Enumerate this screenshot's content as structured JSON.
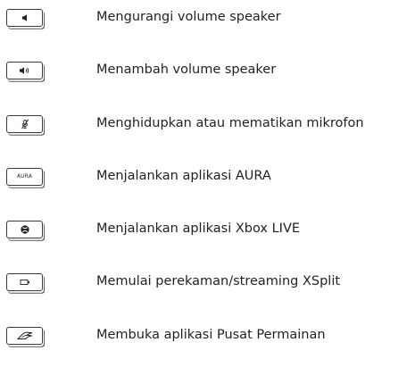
{
  "hotkeys": [
    {
      "icon": "volume-down-icon",
      "key_text": "",
      "description": "Mengurangi volume speaker"
    },
    {
      "icon": "volume-up-icon",
      "key_text": "",
      "description": "Menambah volume speaker"
    },
    {
      "icon": "mic-mute-icon",
      "key_text": "",
      "description": "Menghidupkan atau mematikan mikrofon"
    },
    {
      "icon": "aura-text-icon",
      "key_text": "AURA",
      "description": "Menjalankan aplikasi AURA"
    },
    {
      "icon": "xbox-icon",
      "key_text": "",
      "description": "Menjalankan aplikasi Xbox LIVE"
    },
    {
      "icon": "record-icon",
      "key_text": "",
      "description": "Memulai perekaman/streaming XSplit"
    },
    {
      "icon": "rog-logo-icon",
      "key_text": "",
      "description": "Membuka aplikasi Pusat Permainan"
    }
  ]
}
